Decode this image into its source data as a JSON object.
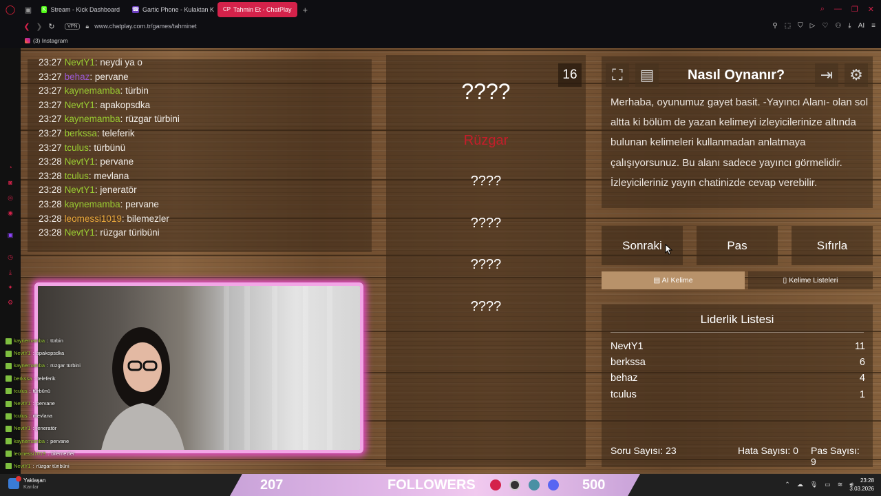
{
  "browser": {
    "tabs": [
      {
        "label": "Stream - Kick Dashboard",
        "fav": "K",
        "fav_color": "#53fc18",
        "active": false
      },
      {
        "label": "Gartic Phone - Kulaktan K",
        "fav": "☎",
        "fav_color": "#6a3dbd",
        "active": false
      },
      {
        "label": "Tahmin Et - ChatPlay",
        "fav": "CP",
        "fav_color": "#d4224a",
        "active": true
      }
    ],
    "vpn": "VPN",
    "url": "www.chatplay.com.tr/games/tahminet",
    "bookmark": "(3) Instagram",
    "ai_label": "AI"
  },
  "chat": {
    "messages": [
      {
        "time": "23:27",
        "user": "NevtY1",
        "color": "#9acd32",
        "text": "neydi ya o"
      },
      {
        "time": "23:27",
        "user": "behaz",
        "color": "#9b59d0",
        "text": "pervane"
      },
      {
        "time": "23:27",
        "user": "kaynemamba",
        "color": "#9acd32",
        "text": "türbin"
      },
      {
        "time": "23:27",
        "user": "NevtY1",
        "color": "#9acd32",
        "text": "apakopsdka"
      },
      {
        "time": "23:27",
        "user": "kaynemamba",
        "color": "#9acd32",
        "text": "rüzgar türbini"
      },
      {
        "time": "23:27",
        "user": "berkssa",
        "color": "#9acd32",
        "text": "teleferik"
      },
      {
        "time": "23:27",
        "user": "tculus",
        "color": "#9acd32",
        "text": "türbünü"
      },
      {
        "time": "23:28",
        "user": "NevtY1",
        "color": "#9acd32",
        "text": "pervane"
      },
      {
        "time": "23:28",
        "user": "tculus",
        "color": "#9acd32",
        "text": "mevlana"
      },
      {
        "time": "23:28",
        "user": "NevtY1",
        "color": "#9acd32",
        "text": "jeneratör"
      },
      {
        "time": "23:28",
        "user": "kaynemamba",
        "color": "#9acd32",
        "text": "pervane"
      },
      {
        "time": "23:28",
        "user": "leomessi1019",
        "color": "#e8a73b",
        "text": "bilemezler"
      },
      {
        "time": "23:28",
        "user": "NevtY1",
        "color": "#9acd32",
        "text": "rüzgar türibüni"
      }
    ]
  },
  "overlay_chat": [
    {
      "user": "kaynemamba",
      "text": "türbin"
    },
    {
      "user": "NevtY1",
      "text": "apakopsdka"
    },
    {
      "user": "kaynemamba",
      "text": "rüzgar türbini"
    },
    {
      "user": "berkssa",
      "text": "teleferik"
    },
    {
      "user": "tculus",
      "text": "türbünü"
    },
    {
      "user": "NevtY1",
      "text": "pervane"
    },
    {
      "user": "tculus",
      "text": "mevlana"
    },
    {
      "user": "NevtY1",
      "text": "jeneratör"
    },
    {
      "user": "kaynemamba",
      "text": "pervane"
    },
    {
      "user": "leomessi1019",
      "text": "bilemezler"
    },
    {
      "user": "NevtY1",
      "text": "rüzgar türibüni"
    }
  ],
  "words": {
    "main": "????",
    "forbidden_first": "Rüzgar",
    "others": [
      "????",
      "????",
      "????",
      "????"
    ],
    "counter": "16"
  },
  "how_to": {
    "title": "Nasıl Oynanır?",
    "body": "Merhaba, oyunumuz gayet basit. -Yayıncı Alanı- olan sol altta ki bölüm de yazan kelimeyi izleyicilerinize altında bulunan kelimeleri kullanmadan anlatmaya çalışıyorsunuz. Bu alanı sadece yayıncı görmelidir. İzleyicileriniz yayın chatinizde cevap verebilir."
  },
  "actions": {
    "next": "Sonraki",
    "pass": "Pas",
    "reset": "Sıfırla",
    "ai_word": "AI Kelime",
    "word_lists": "Kelime Listeleri"
  },
  "leaderboard": {
    "title": "Liderlik Listesi",
    "rows": [
      {
        "name": "NevtY1",
        "score": "11"
      },
      {
        "name": "berkssa",
        "score": "6"
      },
      {
        "name": "behaz",
        "score": "4"
      },
      {
        "name": "tculus",
        "score": "1"
      }
    ],
    "question_count": "Soru Sayısı: 23",
    "error_count": "Hata Sayısı: 0",
    "pass_count": "Pas Sayısı: 9"
  },
  "taskbar": {
    "weather_title": "Yaklaşan",
    "weather_sub": "Karılar",
    "followers_current": "207",
    "followers_label": "FOLLOWERS",
    "followers_goal": "500",
    "time": "23:28",
    "date": "3.03.2026"
  }
}
